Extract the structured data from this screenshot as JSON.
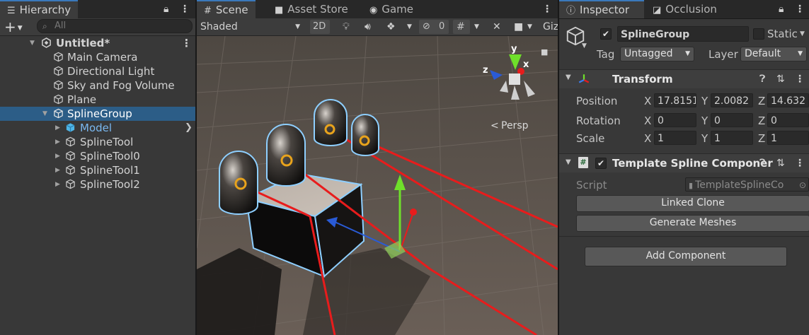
{
  "hierarchy": {
    "tab": "Hierarchy",
    "add_label": "+",
    "search_placeholder": "All",
    "scene_name": "Untitled*",
    "items": [
      {
        "label": "Main Camera"
      },
      {
        "label": "Directional Light"
      },
      {
        "label": "Sky and Fog Volume"
      },
      {
        "label": "Plane"
      },
      {
        "label": "SplineGroup"
      },
      {
        "label": "Model"
      },
      {
        "label": "SplineTool"
      },
      {
        "label": "SplineTool0"
      },
      {
        "label": "SplineTool1"
      },
      {
        "label": "SplineTool2"
      }
    ]
  },
  "scene": {
    "tabs": {
      "scene": "Scene",
      "asset_store": "Asset Store",
      "game": "Game"
    },
    "shading_mode": "Shaded",
    "mode_2d": "2D",
    "hidden_count": "0",
    "gizmos_label": "Giz",
    "projection_label": "Persp",
    "axis_x": "x",
    "axis_y": "y",
    "axis_z": "z"
  },
  "inspector": {
    "tabs": {
      "inspector": "Inspector",
      "occlusion": "Occlusion"
    },
    "object_name": "SplineGroup",
    "static_label": "Static",
    "tag_label": "Tag",
    "tag_value": "Untagged",
    "layer_label": "Layer",
    "layer_value": "Default",
    "transform": {
      "title": "Transform",
      "position_label": "Position",
      "rotation_label": "Rotation",
      "scale_label": "Scale",
      "axis_x": "X",
      "axis_y": "Y",
      "axis_z": "Z",
      "position": {
        "x": "17.8151",
        "y": "2.0082",
        "z": "14.632"
      },
      "rotation": {
        "x": "0",
        "y": "0",
        "z": "0"
      },
      "scale": {
        "x": "1",
        "y": "1",
        "z": "1"
      }
    },
    "component": {
      "title": "Template Spline Componer",
      "script_label": "Script",
      "script_value": "TemplateSplineCo",
      "linked_clone_button": "Linked Clone",
      "generate_meshes_button": "Generate Meshes"
    },
    "add_component_button": "Add Component"
  }
}
